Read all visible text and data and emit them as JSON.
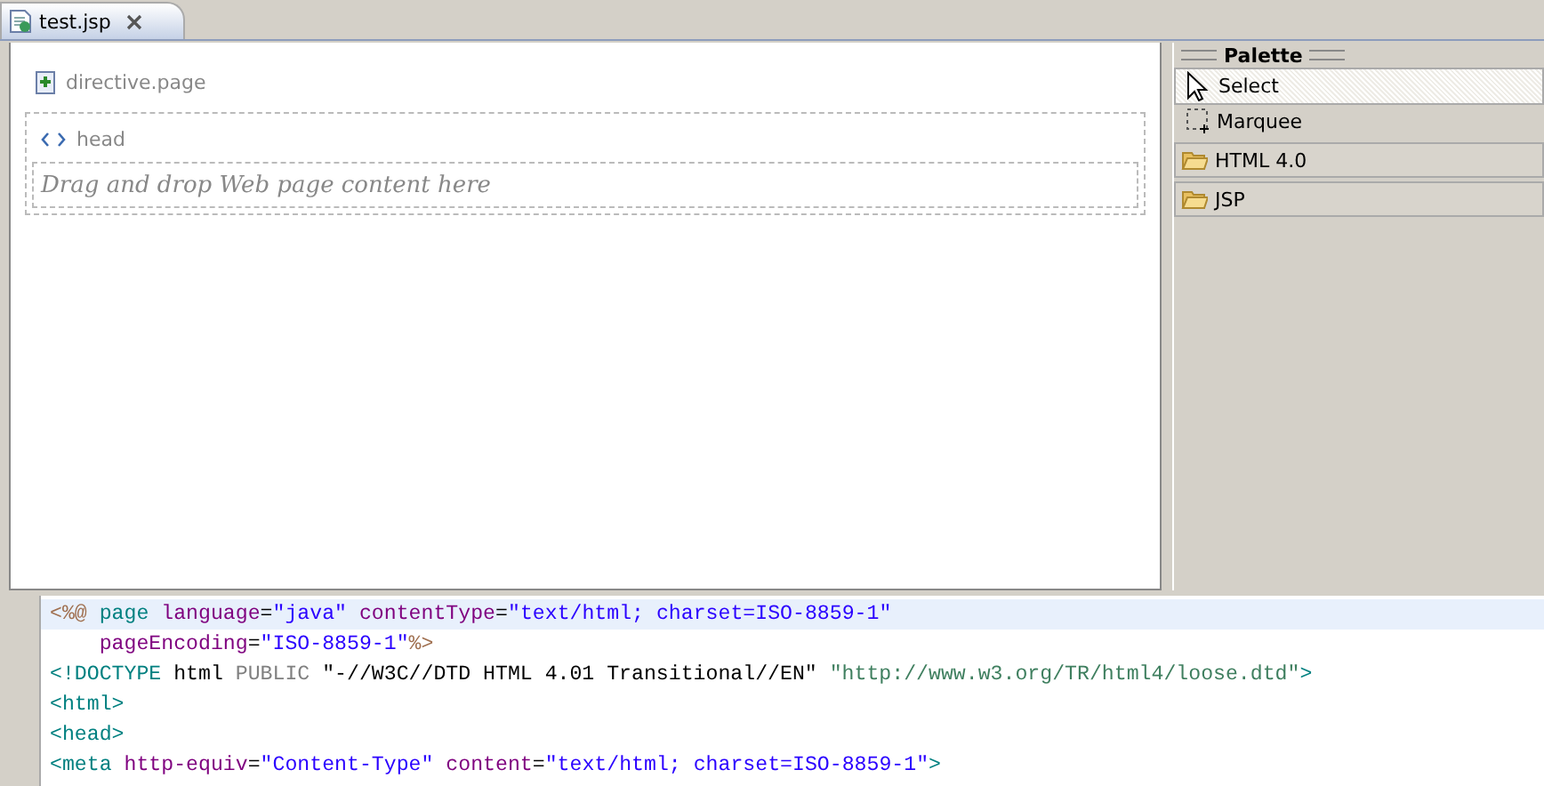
{
  "tabs": [
    {
      "label": "test.jsp",
      "selected": true
    }
  ],
  "design": {
    "directive": "directive.page",
    "head": "head",
    "drop_hint": "Drag and drop Web page content here"
  },
  "palette": {
    "title": "Palette",
    "tools": [
      {
        "label": "Select",
        "kind": "arrow",
        "selected": true
      },
      {
        "label": "Marquee",
        "kind": "marquee",
        "selected": false
      }
    ],
    "drawers": [
      {
        "label": "HTML 4.0"
      },
      {
        "label": "JSP"
      }
    ]
  },
  "code_lines": [
    {
      "selected": true,
      "tokens": [
        {
          "kind": "punct",
          "text": "<%@"
        },
        {
          "kind": "tag",
          "text": " page "
        },
        {
          "kind": "attr",
          "text": "language"
        },
        {
          "kind": "plain",
          "text": "="
        },
        {
          "kind": "value",
          "text": "\"java\""
        },
        {
          "kind": "attr",
          "text": " contentType"
        },
        {
          "kind": "plain",
          "text": "="
        },
        {
          "kind": "value",
          "text": "\"text/html; charset=ISO-8859-1\""
        }
      ]
    },
    {
      "selected": false,
      "tokens": [
        {
          "kind": "attr",
          "text": "    pageEncoding"
        },
        {
          "kind": "plain",
          "text": "="
        },
        {
          "kind": "value",
          "text": "\"ISO-8859-1\""
        },
        {
          "kind": "punct",
          "text": "%>"
        }
      ]
    },
    {
      "selected": false,
      "tokens": [
        {
          "kind": "tag",
          "text": "<!DOCTYPE"
        },
        {
          "kind": "plain",
          "text": " html "
        },
        {
          "kind": "keyword",
          "text": "PUBLIC"
        },
        {
          "kind": "plain",
          "text": " \"-//W3C//DTD HTML 4.01 Transitional//EN\" "
        },
        {
          "kind": "string",
          "text": "\"http://www.w3.org/TR/html4/loose.dtd\""
        },
        {
          "kind": "tag",
          "text": ">"
        }
      ]
    },
    {
      "selected": false,
      "tokens": [
        {
          "kind": "tag",
          "text": "<html>"
        }
      ]
    },
    {
      "selected": false,
      "tokens": [
        {
          "kind": "tag",
          "text": "<head>"
        }
      ]
    },
    {
      "selected": false,
      "tokens": [
        {
          "kind": "tag",
          "text": "<meta "
        },
        {
          "kind": "attr",
          "text": "http-equiv"
        },
        {
          "kind": "plain",
          "text": "="
        },
        {
          "kind": "value",
          "text": "\"Content-Type\""
        },
        {
          "kind": "attr",
          "text": " content"
        },
        {
          "kind": "plain",
          "text": "="
        },
        {
          "kind": "value",
          "text": "\"text/html; charset=ISO-8859-1\""
        },
        {
          "kind": "tag",
          "text": ">"
        }
      ]
    }
  ]
}
